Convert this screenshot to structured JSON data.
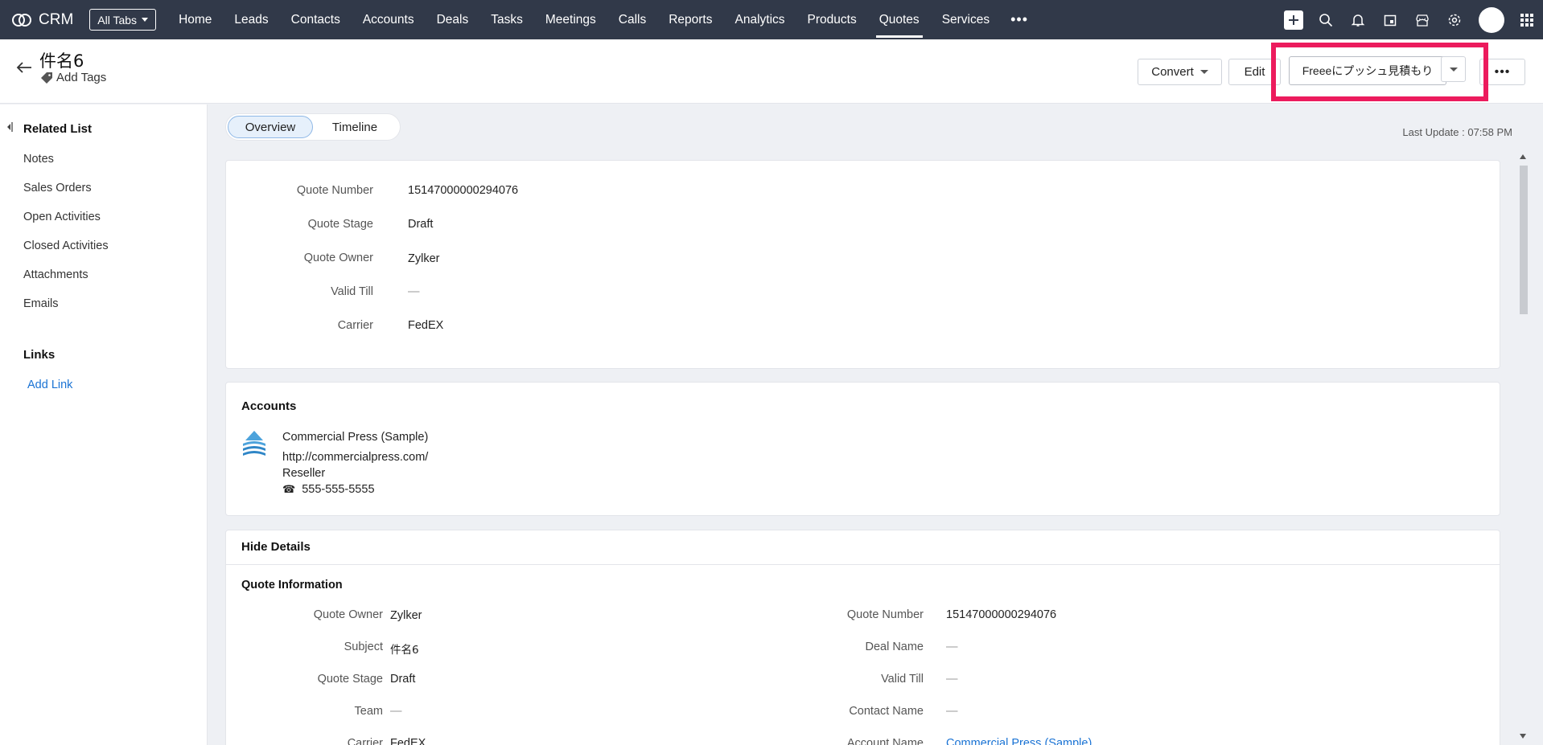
{
  "topbar": {
    "brand": "CRM",
    "all_tabs": "All Tabs",
    "nav": [
      "Home",
      "Leads",
      "Contacts",
      "Accounts",
      "Deals",
      "Tasks",
      "Meetings",
      "Calls",
      "Reports",
      "Analytics",
      "Products",
      "Quotes",
      "Services"
    ],
    "active_nav": "Quotes",
    "more": "•••"
  },
  "header": {
    "title": "件名6",
    "add_tags": "Add Tags",
    "convert": "Convert",
    "edit": "Edit",
    "freee": "Freeeにプッシュ見積もり",
    "more": "•••"
  },
  "sidebar": {
    "related_heading": "Related List",
    "related_items": [
      "Notes",
      "Sales Orders",
      "Open Activities",
      "Closed Activities",
      "Attachments",
      "Emails"
    ],
    "links_heading": "Links",
    "add_link": "Add Link"
  },
  "tabs": {
    "overview": "Overview",
    "timeline": "Timeline"
  },
  "last_update": "Last Update : 07:58 PM",
  "summary": {
    "fields": [
      {
        "label": "Quote Number",
        "value": "15147000000294076"
      },
      {
        "label": "Quote Stage",
        "value": "Draft"
      },
      {
        "label": "Quote Owner",
        "value": "Zylker"
      },
      {
        "label": "Valid Till",
        "value": "—"
      },
      {
        "label": "Carrier",
        "value": "FedEX"
      }
    ]
  },
  "accounts": {
    "title": "Accounts",
    "name": "Commercial Press (Sample)",
    "url": "http://commercialpress.com/",
    "type": "Reseller",
    "phone": "555-555-5555"
  },
  "details": {
    "hide": "Hide Details",
    "section": "Quote Information",
    "left": [
      {
        "label": "Quote Owner",
        "value": "Zylker"
      },
      {
        "label": "Subject",
        "value": "件名6"
      },
      {
        "label": "Quote Stage",
        "value": "Draft"
      },
      {
        "label": "Team",
        "value": "—"
      },
      {
        "label": "Carrier",
        "value": "FedEX"
      }
    ],
    "right": [
      {
        "label": "Quote Number",
        "value": "15147000000294076"
      },
      {
        "label": "Deal Name",
        "value": "—"
      },
      {
        "label": "Valid Till",
        "value": "—"
      },
      {
        "label": "Contact Name",
        "value": "—"
      },
      {
        "label": "Account Name",
        "value": "Commercial Press (Sample)"
      }
    ]
  }
}
